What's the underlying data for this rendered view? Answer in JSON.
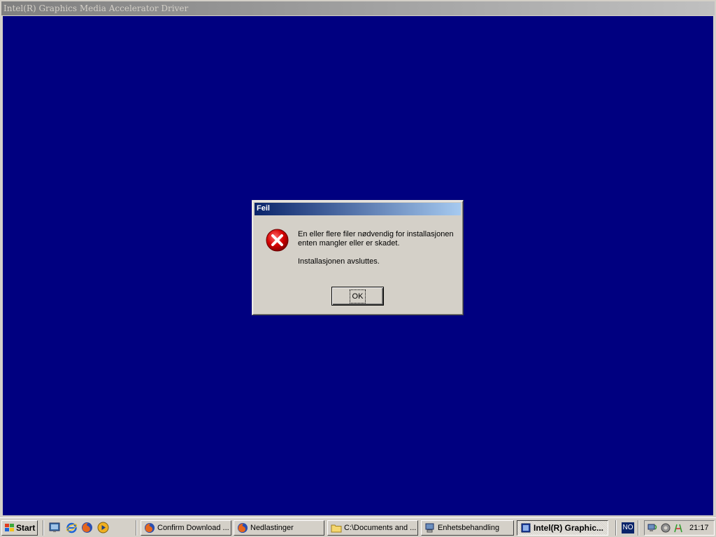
{
  "installer": {
    "title": "Intel(R) Graphics Media Accelerator Driver"
  },
  "dialog": {
    "title": "Feil",
    "message_line1": "En eller flere filer nødvendig for installasjonen",
    "message_line2": "enten mangler eller er skadet.",
    "message_line3": "Installasjonen avsluttes.",
    "ok_label": "OK",
    "icon": "error-icon"
  },
  "taskbar": {
    "start_label": "Start",
    "quicklaunch": [
      "show-desktop-icon",
      "internet-explorer-icon",
      "firefox-icon",
      "media-player-icon"
    ],
    "tasks": [
      {
        "label": "Confirm Download ...",
        "icon": "firefox-icon",
        "active": false
      },
      {
        "label": "Nedlastinger",
        "icon": "firefox-icon",
        "active": false
      },
      {
        "label": "C:\\Documents and ...",
        "icon": "folder-icon",
        "active": false
      },
      {
        "label": "Enhetsbehandling",
        "icon": "device-manager-icon",
        "active": false
      },
      {
        "label": "Intel(R) Graphic...",
        "icon": "installer-icon",
        "active": true
      }
    ],
    "language": "NO",
    "tray_icons": [
      "network-icon",
      "volume-icon",
      "wireless-icon"
    ],
    "clock": "21:17"
  },
  "colors": {
    "desktop_blue": "#000080",
    "dialog_title_start": "#0a246a",
    "dialog_title_end": "#a6caf0",
    "error_red": "#cc0000"
  }
}
